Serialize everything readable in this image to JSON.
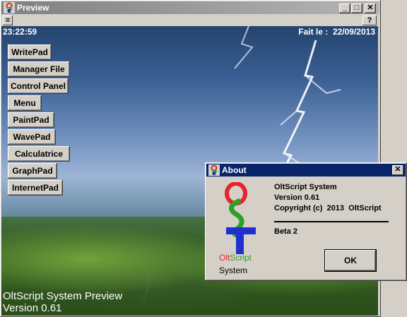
{
  "window": {
    "title": "Preview",
    "controls": {
      "minimize": "_",
      "maximize": "□",
      "close": "✕"
    }
  },
  "menubar": {
    "left_button": "=",
    "help_button": "?"
  },
  "status": {
    "time": "23:22:59",
    "date_label": "Fait le :",
    "date": "22/09/2013"
  },
  "nav": [
    "WritePad",
    "Manager File",
    "Control Panel",
    "Menu",
    "PaintPad",
    "WavePad",
    "Calculatrice",
    "GraphPad",
    "InternetPad"
  ],
  "footer": {
    "line1": "OltScript System Preview",
    "line2": "Version 0.61"
  },
  "about": {
    "title": "About",
    "close": "✕",
    "logo_text": {
      "part1": "Olt",
      "part2": "Script",
      "part3": "System"
    },
    "info": {
      "name": "OltScript System",
      "version": "Version 0.61",
      "copyright": "Copyright (c)  2013  OltScript"
    },
    "beta": "Beta 2",
    "ok_label": "OK"
  },
  "colors": {
    "title_inactive": "#808080",
    "title_active": "#0a246a",
    "logo_red": "#e8242a",
    "logo_green": "#2ca02c",
    "logo_blue": "#1f2fd0"
  }
}
